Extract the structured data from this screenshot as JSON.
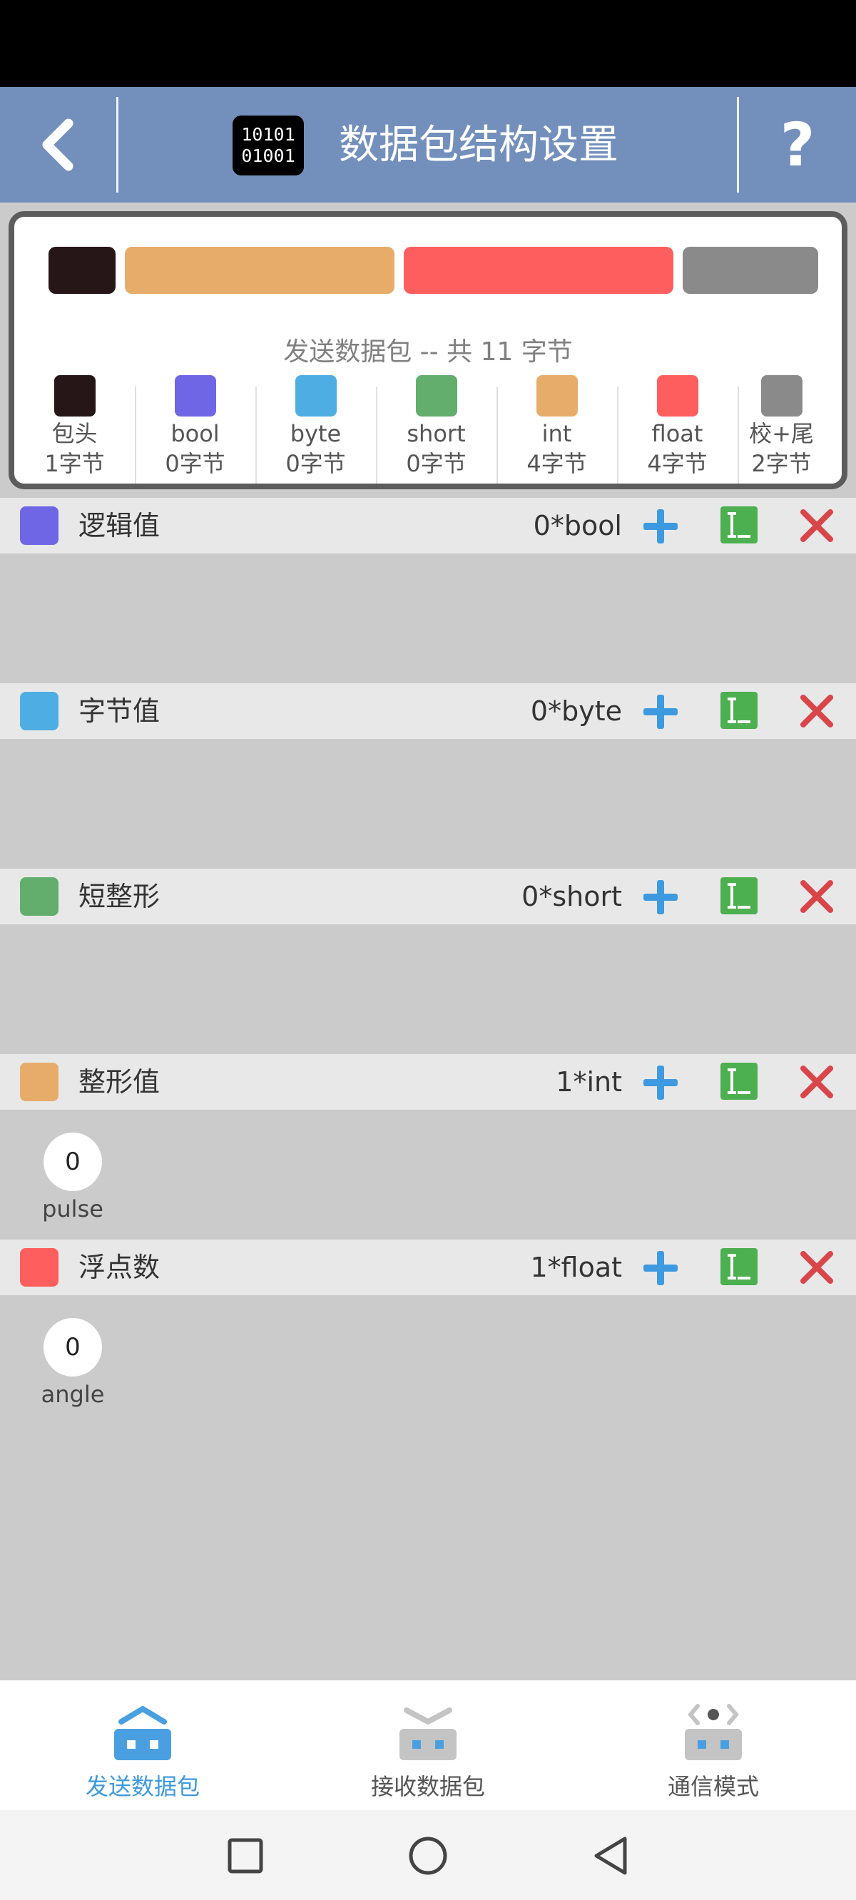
{
  "header": {
    "title": "数据包结构设置",
    "logo_line1": "10101",
    "logo_line2": "01001",
    "help": "?"
  },
  "summary": {
    "label": "发送数据包 -- 共 11 字节",
    "bars": [
      {
        "type": "包头",
        "color": "#261617",
        "bytes": 1
      },
      {
        "type": "int",
        "color": "#e8ac6a",
        "bytes": 4
      },
      {
        "type": "float",
        "color": "#ff5e5e",
        "bytes": 4
      },
      {
        "type": "校+尾",
        "color": "#8a8a8a",
        "bytes": 2
      }
    ],
    "legend": [
      {
        "name": "包头",
        "size": "1字节",
        "color": "#261617"
      },
      {
        "name": "bool",
        "size": "0字节",
        "color": "#6f66e6"
      },
      {
        "name": "byte",
        "size": "0字节",
        "color": "#4eaee3"
      },
      {
        "name": "short",
        "size": "0字节",
        "color": "#63ad6d"
      },
      {
        "name": "int",
        "size": "4字节",
        "color": "#e8ac6a"
      },
      {
        "name": "float",
        "size": "4字节",
        "color": "#ff5e5e"
      },
      {
        "name": "校+尾",
        "size": "2字节",
        "color": "#8a8a8a"
      }
    ]
  },
  "sections": [
    {
      "name": "逻辑值",
      "count": "0*bool",
      "color": "#6f66e6",
      "fields": []
    },
    {
      "name": "字节值",
      "count": "0*byte",
      "color": "#4eaee3",
      "fields": []
    },
    {
      "name": "短整形",
      "count": "0*short",
      "color": "#63ad6d",
      "fields": []
    },
    {
      "name": "整形值",
      "count": "1*int",
      "color": "#e8ac6a",
      "fields": [
        {
          "value": "0",
          "label": "pulse"
        }
      ]
    },
    {
      "name": "浮点数",
      "count": "1*float",
      "color": "#ff5e5e",
      "fields": [
        {
          "value": "0",
          "label": "angle"
        }
      ]
    }
  ],
  "tabs": [
    {
      "label": "发送数据包",
      "active": true,
      "icon": "send-package-icon"
    },
    {
      "label": "接收数据包",
      "active": false,
      "icon": "receive-package-icon"
    },
    {
      "label": "通信模式",
      "active": false,
      "icon": "communication-mode-icon"
    }
  ],
  "colors": {
    "header_bg": "#7390bd",
    "active_tab": "#4a9fe0",
    "inactive_tab": "#c4c4c4",
    "add": "#3d9ae0",
    "edit": "#4caf50",
    "delete": "#d9464a"
  }
}
